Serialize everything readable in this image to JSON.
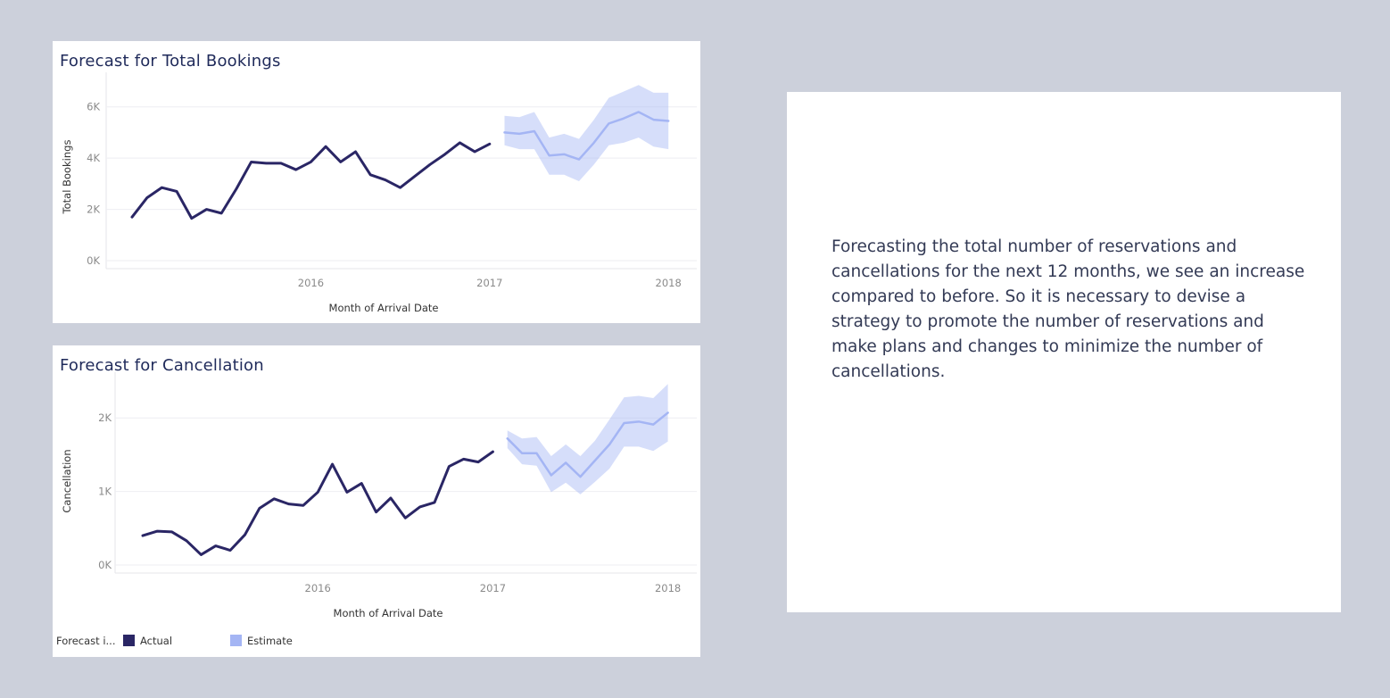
{
  "legend": {
    "title": "Forecast i...",
    "items": [
      {
        "label": "Actual",
        "color": "#2a2665"
      },
      {
        "label": "Estimate",
        "color": "#a4b5f4"
      }
    ]
  },
  "description": "Forecasting the total number of reservations and cancellations for the next 12 months, we see an increase compared to before. So it is necessary to devise a strategy to promote the number of reservations and make plans and changes to minimize the number of cancellations.",
  "chart_data": [
    {
      "type": "line",
      "title": "Forecast for Total Bookings",
      "xlabel": "Month of Arrival Date",
      "ylabel": "Total Bookings",
      "x_ticks": [
        "2016",
        "2017",
        "2018"
      ],
      "y_ticks": [
        {
          "v": 0,
          "label": "0K"
        },
        {
          "v": 2000,
          "label": "2K"
        },
        {
          "v": 4000,
          "label": "4K"
        },
        {
          "v": 6000,
          "label": "6K"
        }
      ],
      "ylim": [
        0,
        7000
      ],
      "grid": true,
      "series": [
        {
          "name": "Actual",
          "x": [
            "2015-07",
            "2015-08",
            "2015-09",
            "2015-10",
            "2015-11",
            "2015-12",
            "2016-01",
            "2016-02",
            "2016-03",
            "2016-04",
            "2016-05",
            "2016-06",
            "2016-07",
            "2016-08",
            "2016-09",
            "2016-10",
            "2016-11",
            "2016-12",
            "2017-01",
            "2017-02",
            "2017-03",
            "2017-04",
            "2017-05",
            "2017-06",
            "2017-07",
            "2017-08"
          ],
          "values": [
            1700,
            2450,
            2850,
            2700,
            1650,
            2000,
            1850,
            2800,
            3850,
            3800,
            3800,
            3550,
            3850,
            4450,
            3850,
            4250,
            3350,
            3150,
            2850,
            3300,
            3750,
            4150,
            4600,
            4250,
            4550,
            null
          ]
        },
        {
          "name": "Estimate",
          "x": [
            "2017-08",
            "2017-09",
            "2017-10",
            "2017-11",
            "2017-12",
            "2018-01",
            "2018-02",
            "2018-03",
            "2018-04",
            "2018-05",
            "2018-06",
            "2018-07"
          ],
          "values": [
            5000,
            4950,
            5050,
            4100,
            4150,
            3950,
            4600,
            5350,
            5550,
            5800,
            5500,
            5450
          ],
          "upper": [
            5650,
            5600,
            5800,
            4800,
            4950,
            4750,
            5500,
            6350,
            6600,
            6850,
            6550,
            6550
          ],
          "lower": [
            4500,
            4350,
            4350,
            3350,
            3350,
            3100,
            3750,
            4500,
            4600,
            4800,
            4450,
            4350
          ]
        }
      ]
    },
    {
      "type": "line",
      "title": "Forecast for Cancellation",
      "xlabel": "Month of Arrival Date",
      "ylabel": "Cancellation",
      "x_ticks": [
        "2016",
        "2017",
        "2018"
      ],
      "y_ticks": [
        {
          "v": 0,
          "label": "0K"
        },
        {
          "v": 1000,
          "label": "1K"
        },
        {
          "v": 2000,
          "label": "2K"
        }
      ],
      "ylim": [
        0,
        2500
      ],
      "grid": true,
      "series": [
        {
          "name": "Actual",
          "x": [
            "2015-07",
            "2015-08",
            "2015-09",
            "2015-10",
            "2015-11",
            "2015-12",
            "2016-01",
            "2016-02",
            "2016-03",
            "2016-04",
            "2016-05",
            "2016-06",
            "2016-07",
            "2016-08",
            "2016-09",
            "2016-10",
            "2016-11",
            "2016-12",
            "2017-01",
            "2017-02",
            "2017-03",
            "2017-04",
            "2017-05",
            "2017-06",
            "2017-07",
            "2017-08"
          ],
          "values": [
            400,
            460,
            450,
            330,
            140,
            260,
            200,
            410,
            770,
            900,
            830,
            810,
            990,
            1370,
            990,
            1110,
            720,
            910,
            640,
            790,
            850,
            1340,
            1440,
            1400,
            1540,
            null
          ]
        },
        {
          "name": "Estimate",
          "x": [
            "2017-08",
            "2017-09",
            "2017-10",
            "2017-11",
            "2017-12",
            "2018-01",
            "2018-02",
            "2018-03",
            "2018-04",
            "2018-05",
            "2018-06",
            "2018-07"
          ],
          "values": [
            1720,
            1520,
            1520,
            1220,
            1390,
            1200,
            1420,
            1640,
            1930,
            1950,
            1910,
            2070
          ],
          "upper": [
            1830,
            1720,
            1740,
            1480,
            1640,
            1480,
            1690,
            1980,
            2280,
            2300,
            2270,
            2460
          ],
          "lower": [
            1590,
            1370,
            1350,
            990,
            1120,
            960,
            1130,
            1310,
            1610,
            1610,
            1550,
            1680
          ]
        }
      ]
    }
  ]
}
